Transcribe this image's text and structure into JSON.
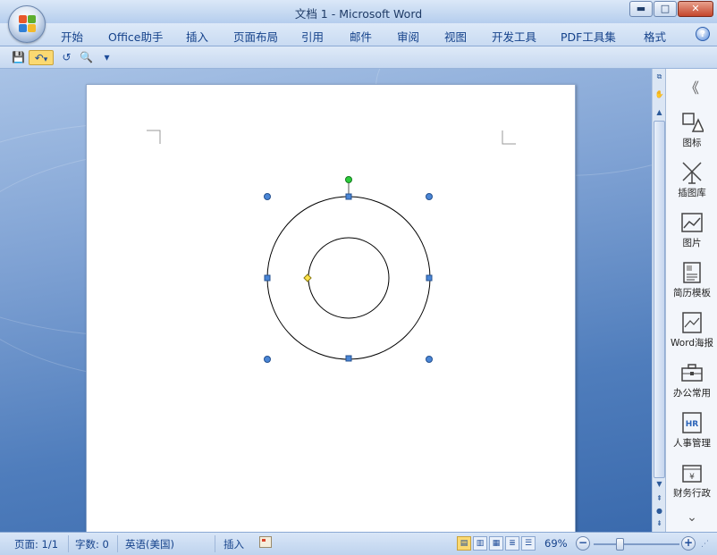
{
  "window": {
    "title": "文档 1 - Microsoft Word",
    "minimize": "▬",
    "maximize": "□",
    "close": "✕"
  },
  "ribbon": {
    "tabs": [
      "开始",
      "Office助手",
      "插入",
      "页面布局",
      "引用",
      "邮件",
      "审阅",
      "视图",
      "开发工具",
      "PDF工具集",
      "格式"
    ],
    "help": "?"
  },
  "qat": {
    "save": "💾",
    "undo": "↶",
    "undo_dropdown": "▾",
    "redo": "↺",
    "print_preview": "🔍",
    "customize": "▾"
  },
  "side_panel": {
    "collapse": "《",
    "items": [
      {
        "label": "图标",
        "icon": "shapes-icon"
      },
      {
        "label": "插图库",
        "icon": "windmill-icon"
      },
      {
        "label": "图片",
        "icon": "picture-icon"
      },
      {
        "label": "简历模板",
        "icon": "resume-icon"
      },
      {
        "label": "Word海报",
        "icon": "poster-icon"
      },
      {
        "label": "办公常用",
        "icon": "briefcase-icon"
      },
      {
        "label": "人事管理",
        "icon": "hr-icon"
      },
      {
        "label": "财务行政",
        "icon": "finance-icon"
      }
    ],
    "more": "⌄"
  },
  "status": {
    "page": "页面: 1/1",
    "words": "字数: 0",
    "language": "英语(美国)",
    "mode": "插入",
    "zoom": "69%",
    "zoom_out": "−",
    "zoom_in": "+"
  },
  "colors": {
    "handle": "#4a86d6",
    "rotate": "#2bcc3a",
    "adjust": "#ffe34a",
    "shape_line": "#000000"
  }
}
